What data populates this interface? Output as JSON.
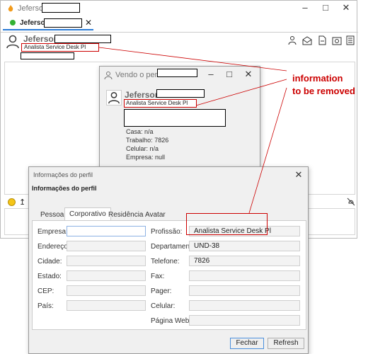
{
  "main_window": {
    "title": "Jeferson",
    "tab_label": "Jeferson",
    "user_name": "Jeferson",
    "user_role": "Analista Service Desk Pl"
  },
  "profile_window": {
    "title": "Vendo o perfil de",
    "user_name": "Jeferson",
    "user_role": "Analista Service Desk Pl",
    "details": [
      "Casa: n/a",
      "Trabalho: 7826",
      "Celular: n/a",
      "Empresa: null"
    ]
  },
  "info_dialog": {
    "title": "Informações do perfil",
    "heading": "Informações do perfil",
    "tabs": [
      "Pessoal",
      "Corporativo",
      "Residência",
      "Avatar"
    ],
    "left_labels": [
      "Empresa:",
      "Endereço:",
      "Cidade:",
      "Estado:",
      "CEP:",
      "País:"
    ],
    "right_labels": [
      "Profissão:",
      "Departamento:",
      "Telefone:",
      "Fax:",
      "Pager:",
      "Celular:",
      "Página Web:"
    ],
    "right_values": [
      "Analista Service Desk Pl",
      "UND-38",
      "7826",
      "",
      "",
      "",
      ""
    ],
    "close_button": "Fechar",
    "refresh_button": "Refresh"
  },
  "annotation": {
    "line1": "information",
    "line2": "to be removed",
    "color": "#cc0000"
  }
}
